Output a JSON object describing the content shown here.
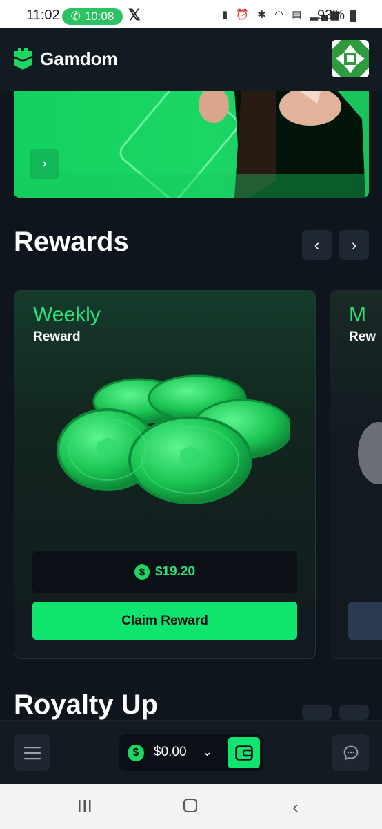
{
  "status_bar": {
    "time": "11:02",
    "call_timer": "10:08",
    "x_label": "𝕏",
    "icons": [
      "sim-icon",
      "alarm-icon",
      "bluetooth-icon",
      "wifi-icon",
      "volte-icon",
      "signal-icon"
    ],
    "battery": "93%"
  },
  "header": {
    "brand": "Gamdom",
    "accent_color": "#1ed760"
  },
  "banner": {
    "next_glyph": "›"
  },
  "rewards": {
    "title": "Rewards",
    "prev_glyph": "‹",
    "next_glyph": "›",
    "cards": [
      {
        "title": "Weekly",
        "subtitle": "Reward",
        "currency_symbol": "$",
        "amount": "$19.20",
        "button_label": "Claim Reward"
      },
      {
        "title": "M",
        "subtitle": "Rew"
      }
    ]
  },
  "royalty": {
    "title": "Royalty Up"
  },
  "bottom_bar": {
    "currency_symbol": "$",
    "balance": "$0.00",
    "chevron": "⌄"
  }
}
